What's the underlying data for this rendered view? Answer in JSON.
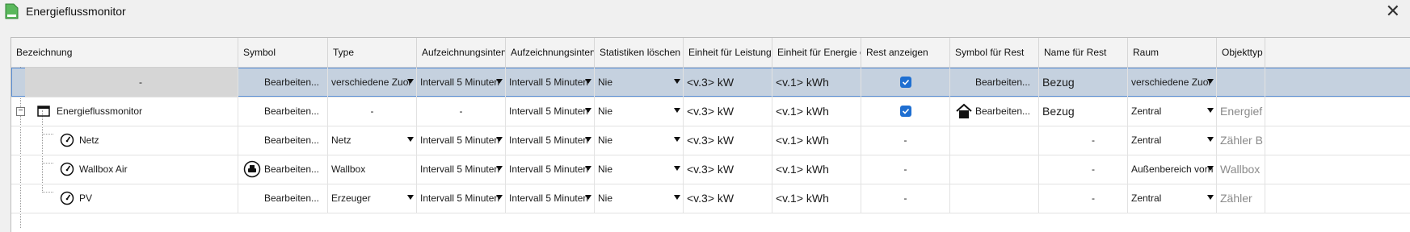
{
  "window": {
    "title": "Energieflussmonitor"
  },
  "columns": [
    "Bezeichnung",
    "Symbol",
    "Type",
    "Aufzeichnungsinterva",
    "Aufzeichnungsinterva",
    "Statistiken löschen",
    "Einheit für Leistung o",
    "Einheit für Energie oc",
    "Rest anzeigen",
    "Symbol für Rest",
    "Name für Rest",
    "Raum",
    "Objekttyp"
  ],
  "rows": [
    {
      "name": "-",
      "symbol": "Bearbeiten...",
      "type": "verschiedene Zuor",
      "int1": "Intervall 5 Minuten",
      "int2": "Intervall 5 Minuten",
      "stat": "Nie",
      "pow": "<v.3> kW",
      "energy": "<v.1> kWh",
      "rest": "checked",
      "restsym": "Bearbeiten...",
      "restname": "Bezug",
      "raum": "verschiedene Zuor",
      "obj": ""
    },
    {
      "name": "Energieflussmonitor",
      "symbol": "Bearbeiten...",
      "type": "-",
      "int1": "-",
      "int2": "Intervall 5 Minuten",
      "stat": "Nie",
      "pow": "<v.3> kW",
      "energy": "<v.1> kWh",
      "rest": "checked",
      "restsym": "Bearbeiten...",
      "restname": "Bezug",
      "raum": "Zentral",
      "obj": "Energief"
    },
    {
      "name": "Netz",
      "symbol": "Bearbeiten...",
      "type": "Netz",
      "int1": "Intervall 5 Minuten",
      "int2": "Intervall 5 Minuten",
      "stat": "Nie",
      "pow": "<v.3> kW",
      "energy": "<v.1> kWh",
      "rest": "-",
      "restsym": "",
      "restname": "-",
      "raum": "Zentral",
      "obj": "Zähler B"
    },
    {
      "name": "Wallbox Air",
      "symbol": "Bearbeiten...",
      "type": "Wallbox",
      "int1": "Intervall 5 Minuten",
      "int2": "Intervall 5 Minuten",
      "stat": "Nie",
      "pow": "<v.3> kW",
      "energy": "<v.1> kWh",
      "rest": "-",
      "restsym": "",
      "restname": "-",
      "raum": "Außenbereich vorn",
      "obj": "Wallbox"
    },
    {
      "name": "PV",
      "symbol": "Bearbeiten...",
      "type": "Erzeuger",
      "int1": "Intervall 5 Minuten",
      "int2": "Intervall 5 Minuten",
      "stat": "Nie",
      "pow": "<v.3> kW",
      "energy": "<v.1> kWh",
      "rest": "-",
      "restsym": "",
      "restname": "-",
      "raum": "Zentral",
      "obj": "Zähler"
    }
  ],
  "colors": {
    "selection": "#c5d1df",
    "selection_gray": "#d6d6d6",
    "checkbox": "#1f6fd1",
    "icon_green": "#3fa34d"
  }
}
